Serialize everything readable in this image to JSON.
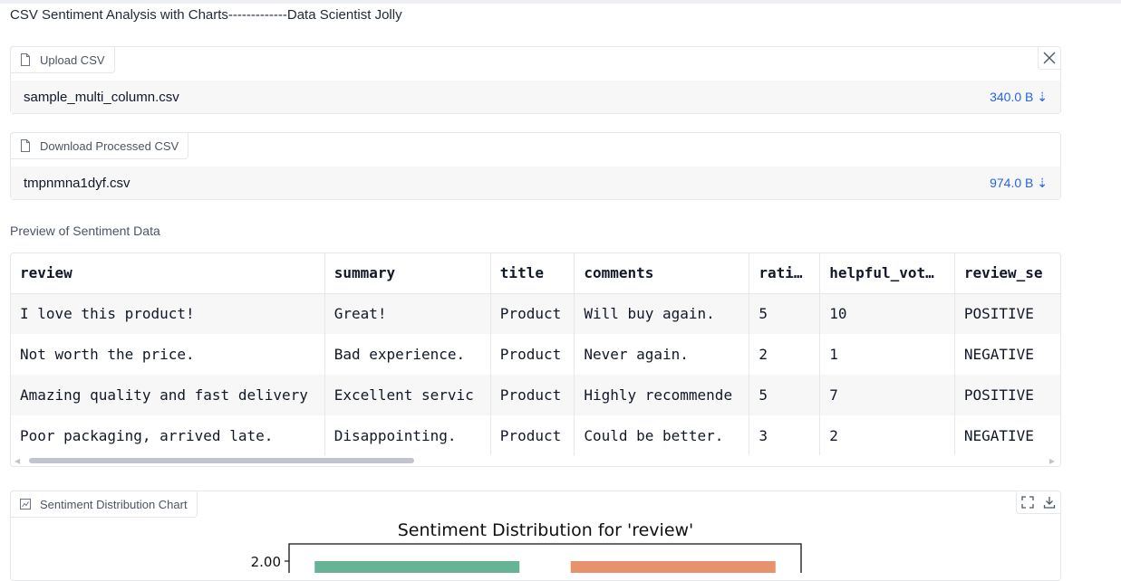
{
  "app": {
    "title": "CSV Sentiment Analysis with Charts-------------Data Scientist Jolly"
  },
  "upload": {
    "label": "Upload CSV",
    "file_name": "sample_multi_column.csv",
    "file_size": "340.0 B ⇣"
  },
  "download": {
    "label": "Download Processed CSV",
    "file_name": "tmpnmna1dyf.csv",
    "file_size": "974.0 B ⇣"
  },
  "preview": {
    "label": "Preview of Sentiment Data",
    "headers": [
      "review",
      "summary",
      "title",
      "comments",
      "rati…",
      "helpful_vot…",
      "review_se"
    ],
    "rows": [
      [
        "I love this product!",
        "Great!",
        "Product",
        "Will buy again.",
        "5",
        "10",
        "POSITIVE"
      ],
      [
        "Not worth the price.",
        "Bad experience.",
        "Product",
        "Never again.",
        "2",
        "1",
        "NEGATIVE"
      ],
      [
        "Amazing quality and fast delivery",
        "Excellent servic",
        "Product",
        "Highly recommende",
        "5",
        "7",
        "POSITIVE"
      ],
      [
        "Poor packaging, arrived late.",
        "Disappointing.",
        "Product",
        "Could be better.",
        "3",
        "2",
        "NEGATIVE"
      ]
    ]
  },
  "chart_block": {
    "label": "Sentiment Distribution Chart",
    "icons": [
      "fullscreen-icon",
      "download-icon"
    ]
  },
  "chart_data": {
    "type": "bar",
    "title": "Sentiment Distribution for 'review'",
    "categories": [],
    "values": [
      2,
      2
    ],
    "bar_colors": [
      "#66b396",
      "#e8926d"
    ],
    "ytick_visible": [
      "2.00"
    ],
    "xlabel": "",
    "ylabel": ""
  }
}
